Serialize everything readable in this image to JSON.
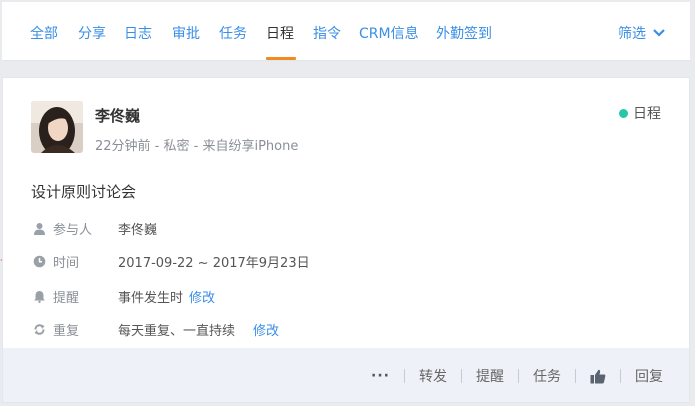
{
  "tabs": [
    {
      "label": "全部"
    },
    {
      "label": "分享"
    },
    {
      "label": "日志"
    },
    {
      "label": "审批"
    },
    {
      "label": "任务"
    },
    {
      "label": "日程"
    },
    {
      "label": "指令"
    },
    {
      "label": "CRM信息"
    },
    {
      "label": "外勤签到"
    }
  ],
  "active_tab": "日程",
  "filter_label": "筛选",
  "post": {
    "author": "李佟巍",
    "meta": "22分钟前 - 私密 - 来自纷享iPhone",
    "type_badge": "日程",
    "title": "设计原则讨论会",
    "fields": {
      "participants_label": "参与人",
      "participants_value": "李佟巍",
      "time_label": "时间",
      "time_value": "2017-09-22 ~ 2017年9月23日",
      "reminder_label": "提醒",
      "reminder_value": "事件发生时",
      "reminder_edit": "修改",
      "repeat_label": "重复",
      "repeat_value": "每天重复、一直持续",
      "repeat_edit": "修改"
    }
  },
  "footer": {
    "more": "···",
    "forward": "转发",
    "remind": "提醒",
    "task": "任务",
    "like_icon": "thumbs-up-icon",
    "reply": "回复"
  },
  "colors": {
    "accent": "#3a8ee6",
    "active_underline": "#f08c1e",
    "status_dot": "#26c6a6",
    "marker_arrow": "#e02020"
  }
}
